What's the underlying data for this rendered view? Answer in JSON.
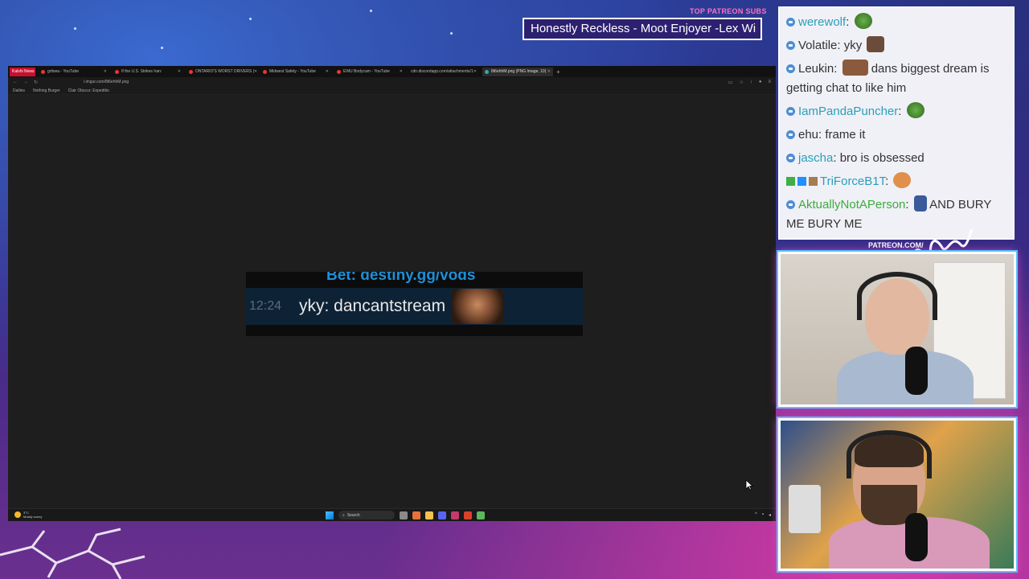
{
  "overlay": {
    "patreon_label": "TOP PATREON SUBS",
    "patreon_ticker": "Honestly Reckless - Moot Enjoyer -Lex Wi",
    "patreon_url": "PATREON.COM/",
    "brand_logo_text": "AnythingElse"
  },
  "browser": {
    "tabs": [
      {
        "label": "Kalshi News",
        "active": false,
        "style": "red"
      },
      {
        "label": "gritsea - YouTube",
        "active": false
      },
      {
        "label": "If the U.S. Strikes Iran:",
        "active": false
      },
      {
        "label": "ONTARIO'S WORST DRIVERS |",
        "active": false
      },
      {
        "label": "Midwest Safety - YouTube",
        "active": false
      },
      {
        "label": "EWU Bodycam - YouTube",
        "active": false
      },
      {
        "label": "cdn.discordapp.com/attachments/1",
        "active": false
      },
      {
        "label": "8t6ehhM.png (PNG Image, 10(",
        "active": true
      }
    ],
    "new_tab": "+",
    "url": "i.imgur.com/8t6ehhM.png",
    "bookmarks": [
      "Dailies",
      "Nothing Burger",
      "Clair Obscur: Expeditio"
    ]
  },
  "chat_image": {
    "top_text": "Bet: destiny.gg/vods",
    "time": "12:24",
    "message": "yky: dancantstream"
  },
  "taskbar": {
    "weather_temp": "3°C",
    "weather_desc": "Mostly sunny",
    "search": "Search"
  },
  "chat": [
    {
      "user": "werewolf",
      "color": "#2a9fb8",
      "text": "",
      "emote": "pepe"
    },
    {
      "user": "Volatile",
      "color": "#333333",
      "text": "yky",
      "emote": "face"
    },
    {
      "user": "Leukin",
      "color": "#333333",
      "text": "dans biggest dream is getting chat to like him",
      "emote": "bear"
    },
    {
      "user": "IamPandaPuncher",
      "color": "#2a9fb8",
      "text": "",
      "emote": "pepe"
    },
    {
      "user": "ehu",
      "color": "#333333",
      "text": "frame it",
      "emote": ""
    },
    {
      "user": "jascha",
      "color": "#2a9fb8",
      "text": "bro is obsessed",
      "emote": ""
    },
    {
      "user": "TriForceB1T",
      "color": "#2a9fb8",
      "text": "",
      "emote": "monkey"
    },
    {
      "user": "AktuallyNotAPerson",
      "color": "#3aae3a",
      "text": "AND BURY ME BURY ME",
      "emote": ""
    }
  ]
}
